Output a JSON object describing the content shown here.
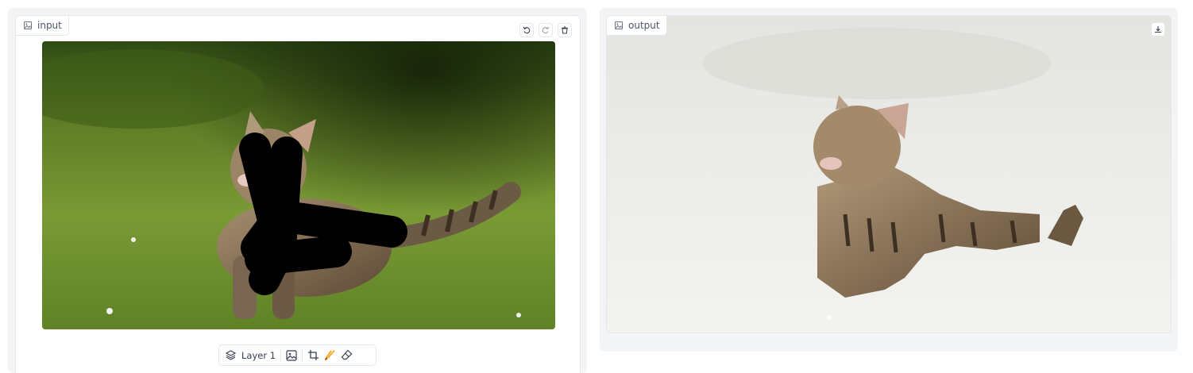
{
  "input_panel": {
    "label": "input",
    "label_icon": "image-icon",
    "actions": [
      "undo-icon",
      "redo-icon",
      "trash-icon"
    ],
    "image_description_icon": "cat-photo",
    "toolbar": {
      "layer_label": "Layer 1",
      "tools": [
        "layers-icon",
        "image-icon",
        "crop-icon",
        "brush-icon",
        "eraser-icon"
      ],
      "accent": "#f59e0b"
    }
  },
  "output_panel": {
    "label": "output",
    "label_icon": "image-icon",
    "actions": [
      "download-icon"
    ]
  }
}
